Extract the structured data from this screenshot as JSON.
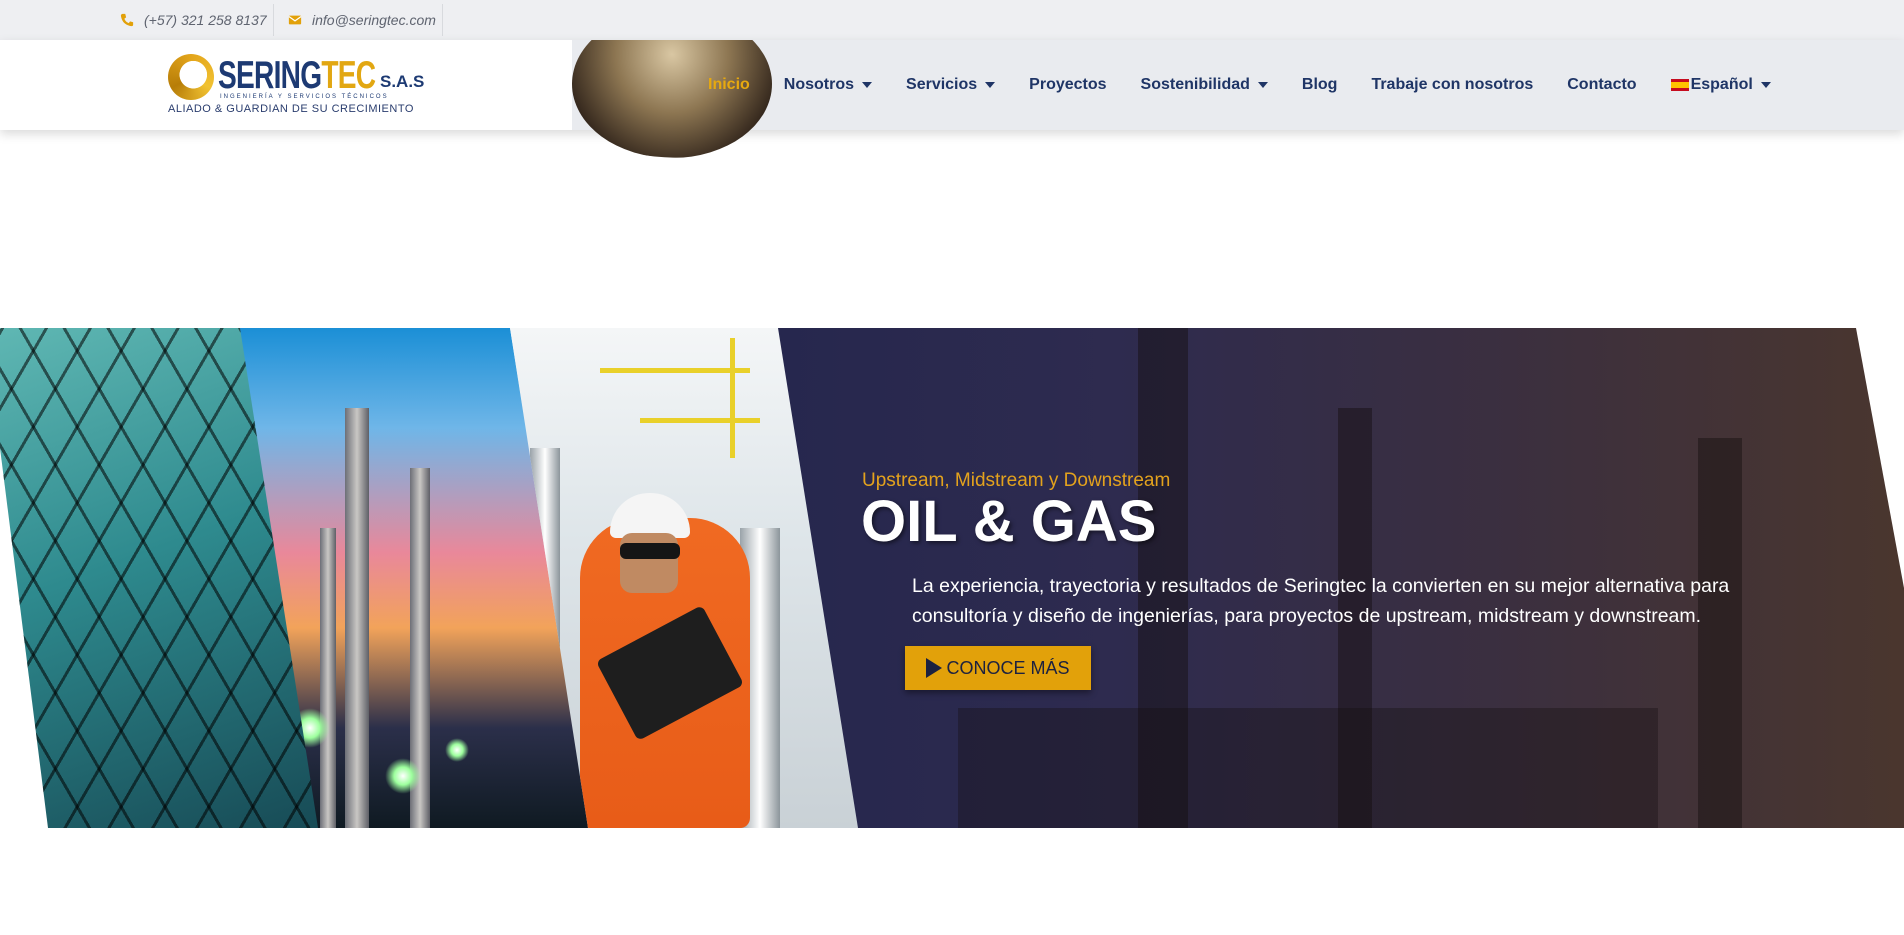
{
  "topbar": {
    "phone": "(+57) 321 258 8137",
    "email": "info@seringtec.com"
  },
  "logo": {
    "word_a": "SERING",
    "word_b": "TEC",
    "suffix": "S.A.S",
    "line1": "INGENIERÍA Y SERVICIOS TÉCNICOS",
    "tagline": "ALIADO & GUARDIAN DE SU CRECIMIENTO"
  },
  "nav": {
    "items": [
      {
        "label": "Inicio",
        "active": true
      },
      {
        "label": "Nosotros"
      },
      {
        "label": "Servicios"
      },
      {
        "label": "Proyectos"
      },
      {
        "label": "Sostenibilidad"
      },
      {
        "label": "Blog"
      },
      {
        "label": "Trabaje con nosotros"
      },
      {
        "label": "Contacto"
      },
      {
        "label": "Español"
      }
    ]
  },
  "hero": {
    "kicker": "Upstream, Midstream y Downstream",
    "title": "OIL & GAS",
    "description": "La experiencia, trayectoria y resultados de Seringtec la convierten en su mejor alternativa para consultoría y diseño de ingenierías, para proyectos de upstream, midstream y downstream.",
    "cta": "CONOCE MÁS"
  },
  "colors": {
    "brand_blue": "#1f3566",
    "accent_gold": "#e2a10a",
    "topbar_bg": "#eeeff2",
    "header_bg": "#e9ebef"
  },
  "icons": {
    "phone": "phone-icon",
    "email": "envelope-icon",
    "dropdown": "caret-down-icon",
    "cta": "play-icon",
    "language": "spain-flag-icon"
  }
}
